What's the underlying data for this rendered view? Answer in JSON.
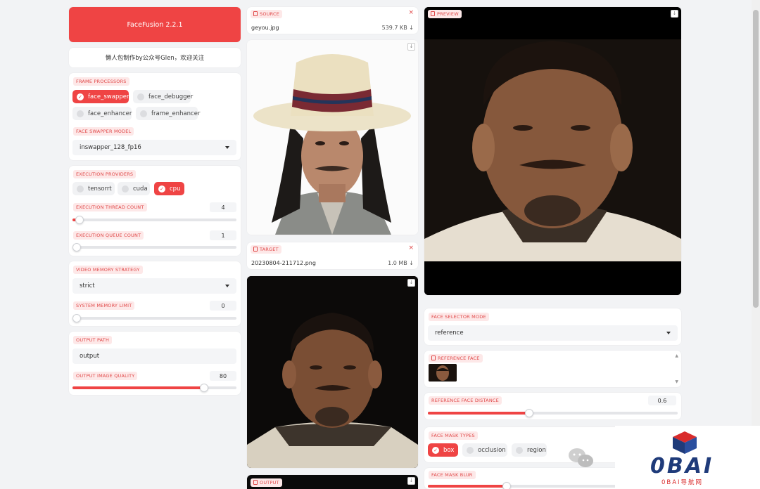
{
  "app": {
    "title": "FaceFusion 2.2.1",
    "subtitle": "懒人包制作by公众号Glen，欢迎关注"
  },
  "frame_processors": {
    "label": "FRAME PROCESSORS",
    "options": [
      {
        "label": "face_swapper",
        "checked": true
      },
      {
        "label": "face_debugger",
        "checked": false
      },
      {
        "label": "face_enhancer",
        "checked": false
      },
      {
        "label": "frame_enhancer",
        "checked": false
      }
    ]
  },
  "face_swapper_model": {
    "label": "FACE SWAPPER MODEL",
    "value": "inswapper_128_fp16"
  },
  "execution_providers": {
    "label": "EXECUTION PROVIDERS",
    "options": [
      {
        "label": "tensorrt",
        "checked": false
      },
      {
        "label": "cuda",
        "checked": false
      },
      {
        "label": "cpu",
        "checked": true
      }
    ]
  },
  "execution_thread_count": {
    "label": "EXECUTION THREAD COUNT",
    "value": "4",
    "fraction": 0.03
  },
  "execution_queue_count": {
    "label": "EXECUTION QUEUE COUNT",
    "value": "1",
    "fraction": 0.0
  },
  "video_memory_strategy": {
    "label": "VIDEO MEMORY STRATEGY",
    "value": "strict"
  },
  "system_memory_limit": {
    "label": "SYSTEM MEMORY LIMIT",
    "value": "0",
    "fraction": 0.0
  },
  "output_path": {
    "label": "OUTPUT PATH",
    "value": "output"
  },
  "output_image_quality": {
    "label": "OUTPUT IMAGE QUALITY",
    "value": "80",
    "fraction": 0.8
  },
  "source": {
    "label": "SOURCE",
    "filename": "geyou.jpg",
    "size": "539.7 KB ↓"
  },
  "target": {
    "label": "TARGET",
    "filename": "20230804-211712.png",
    "size": "1.0 MB ↓"
  },
  "output": {
    "label": "OUTPUT"
  },
  "preview": {
    "label": "PREVIEW"
  },
  "face_selector_mode": {
    "label": "FACE SELECTOR MODE",
    "value": "reference"
  },
  "reference_face": {
    "label": "REFERENCE FACE"
  },
  "reference_face_distance": {
    "label": "REFERENCE FACE DISTANCE",
    "value": "0.6",
    "fraction": 0.4
  },
  "face_mask_types": {
    "label": "FACE MASK TYPES",
    "options": [
      {
        "label": "box",
        "checked": true
      },
      {
        "label": "occlusion",
        "checked": false
      },
      {
        "label": "region",
        "checked": false
      }
    ]
  },
  "face_mask_blur": {
    "label": "FACE MASK BLUR"
  },
  "watermark": {
    "brand": "0BAI",
    "sub": "0BAI导航网"
  },
  "colors": {
    "accent": "#ef4444",
    "label_bg": "#fde8e8"
  }
}
